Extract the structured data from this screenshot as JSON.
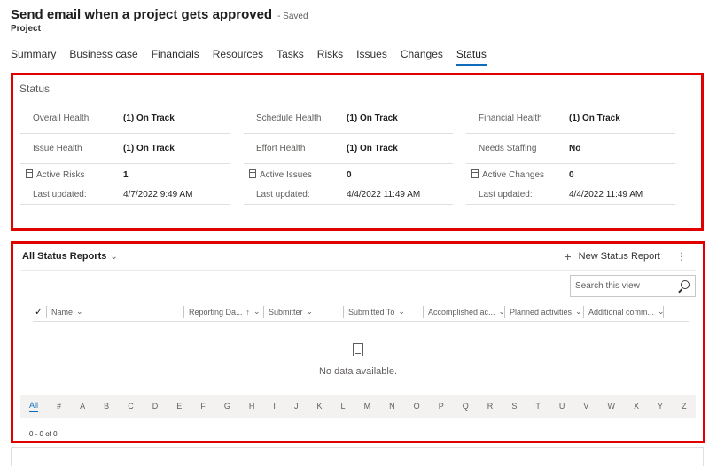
{
  "header": {
    "title": "Send email when a project  gets approved",
    "saved": "- Saved",
    "entity": "Project"
  },
  "tabs": [
    {
      "label": "Summary"
    },
    {
      "label": "Business case"
    },
    {
      "label": "Financials"
    },
    {
      "label": "Resources"
    },
    {
      "label": "Tasks"
    },
    {
      "label": "Risks"
    },
    {
      "label": "Issues"
    },
    {
      "label": "Changes"
    },
    {
      "label": "Status",
      "active": true
    }
  ],
  "status": {
    "title": "Status",
    "columns": [
      [
        {
          "label": "Overall Health",
          "value": "(1) On Track"
        },
        {
          "label": "Issue Health",
          "value": "(1) On Track"
        },
        {
          "label": "Active Risks",
          "value": "1"
        },
        {
          "label": "Last updated:",
          "value": "4/7/2022 9:49 AM"
        }
      ],
      [
        {
          "label": "Schedule Health",
          "value": "(1) On Track"
        },
        {
          "label": "Effort Health",
          "value": "(1) On Track"
        },
        {
          "label": "Active Issues",
          "value": "0"
        },
        {
          "label": "Last updated:",
          "value": "4/4/2022 11:49 AM"
        }
      ],
      [
        {
          "label": "Financial Health",
          "value": "(1) On Track"
        },
        {
          "label": "Needs Staffing",
          "value": "No"
        },
        {
          "label": "Active Changes",
          "value": "0"
        },
        {
          "label": "Last updated:",
          "value": "4/4/2022 11:49 AM"
        }
      ]
    ]
  },
  "grid": {
    "view_name": "All Status Reports",
    "new_label": "New Status Report",
    "search_placeholder": "Search this view",
    "columns": [
      {
        "label": "Name"
      },
      {
        "label": "Reporting Da...",
        "sort": "↑"
      },
      {
        "label": "Submitter"
      },
      {
        "label": "Submitted To"
      },
      {
        "label": "Accomplished ac..."
      },
      {
        "label": "Planned activities"
      },
      {
        "label": "Additional comm..."
      }
    ],
    "empty_text": "No data available.",
    "alphabet": [
      "All",
      "#",
      "A",
      "B",
      "C",
      "D",
      "E",
      "F",
      "G",
      "H",
      "I",
      "J",
      "K",
      "L",
      "M",
      "N",
      "O",
      "P",
      "Q",
      "R",
      "S",
      "T",
      "U",
      "V",
      "W",
      "X",
      "Y",
      "Z"
    ],
    "record_count": "0 - 0 of 0"
  }
}
